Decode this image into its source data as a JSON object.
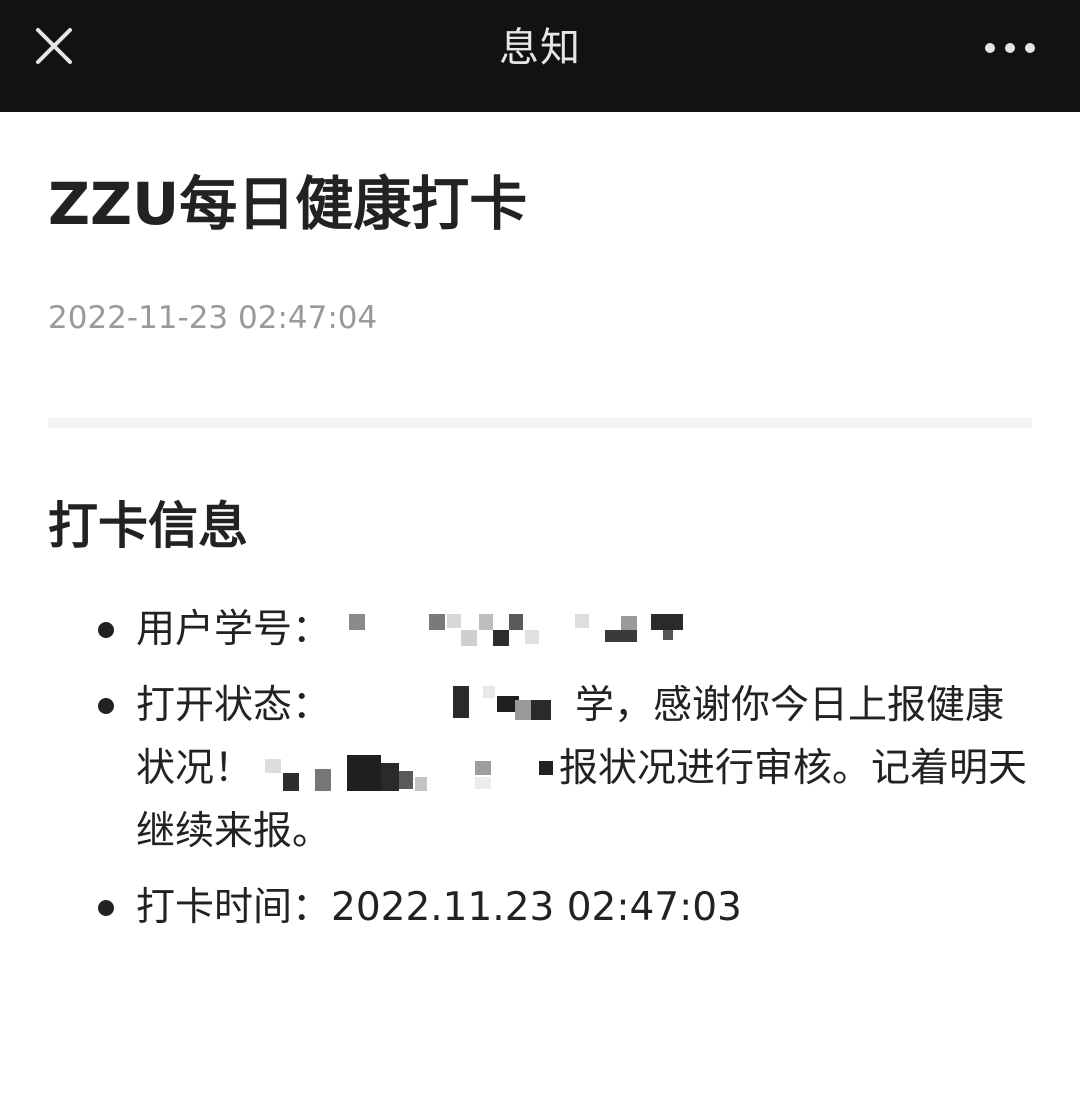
{
  "nav": {
    "title": "息知",
    "close_icon": "close-icon",
    "more_icon": "more-horizontal-icon"
  },
  "message": {
    "title": "ZZU每日健康打卡",
    "time": "2022-11-23 02:47:04"
  },
  "section": {
    "title": "打卡信息"
  },
  "items": [
    {
      "label": "用户学号：",
      "value": ""
    },
    {
      "label": "打开状态：",
      "value_before": "学，感谢你今日上报健康状况！",
      "value_middle": "报状况进行审核。记着明天继续来报。"
    },
    {
      "label": "打卡时间：",
      "value": "2022.11.23 02:47:03"
    }
  ],
  "colors": {
    "nav_bg": "#121212",
    "nav_text": "#e6e6e6",
    "text": "#222222",
    "time": "#9a9a9a"
  }
}
